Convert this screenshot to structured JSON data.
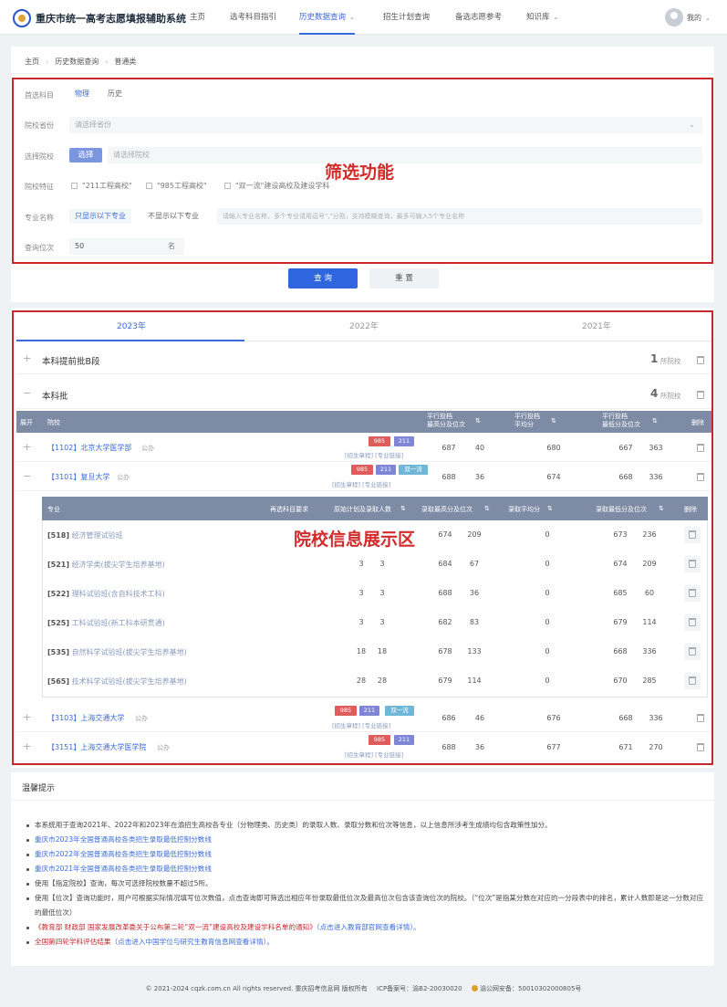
{
  "app": {
    "title": "重庆市统一高考志愿填报辅助系统"
  },
  "nav": {
    "items": [
      {
        "label": "主页"
      },
      {
        "label": "选考科目指引"
      },
      {
        "label": "历史数据查询"
      },
      {
        "label": "招生计划查询"
      },
      {
        "label": "备选志愿参考"
      },
      {
        "label": "知识库"
      }
    ],
    "user_label": "我的"
  },
  "breadcrumb": [
    "主页",
    "历史数据查询",
    "普通类"
  ],
  "filter": {
    "subject_label": "首选科目",
    "subject_options": [
      "物理",
      "历史"
    ],
    "province_label": "院校省份",
    "province_placeholder": "请选择省份",
    "school_label": "选择院校",
    "school_button": "选择",
    "school_placeholder": "请选择院校",
    "feature_label": "院校特征",
    "feature_options": [
      "\"211工程高校\"",
      "\"985工程高校\"",
      "\"双一流\"建设高校及建设学科"
    ],
    "major_label": "专业名称",
    "major_options": [
      "只显示以下专业",
      "不显示以下专业"
    ],
    "major_placeholder": "请输入专业名称，多个专业请用逗号\",\"分割，支持模糊查询，最多可输入5个专业名称",
    "rank_label": "查询位次",
    "rank_value": "50",
    "rank_unit": "名",
    "annotation": "筛选功能"
  },
  "actions": {
    "query": "查 询",
    "reset": "重 置"
  },
  "tabs": [
    "2023年",
    "2022年",
    "2021年"
  ],
  "sections": [
    {
      "title": "本科提前批B段",
      "count": "1",
      "count_label": "所院校"
    },
    {
      "title": "本科批",
      "count": "4",
      "count_label": "所院校"
    }
  ],
  "table_header": {
    "expand": "展开",
    "school": "院校",
    "max": "平行投档\n最高分及位次",
    "avg": "平行投档\n平均分",
    "min": "平行投档\n最低分及位次",
    "delete": "删除"
  },
  "universities": [
    {
      "name": "【1102】北京大学医学部",
      "loc": "公办",
      "tags": [
        "985",
        "211"
      ],
      "links": "[招生章程] [专业链接]",
      "max_score": "687",
      "max_rank": "40",
      "avg": "680",
      "min_score": "667",
      "min_rank": "363"
    },
    {
      "name": "【3101】复旦大学",
      "loc": "公办",
      "tags": [
        "985",
        "211",
        "双一流"
      ],
      "links": "[招生章程] [专业链接]",
      "max_score": "688",
      "max_rank": "36",
      "avg": "674",
      "min_score": "668",
      "min_rank": "336"
    },
    {
      "name": "【3103】上海交通大学",
      "loc": "公办",
      "tags": [
        "985",
        "211",
        "双一流"
      ],
      "links": "[招生章程] [专业链接]",
      "max_score": "686",
      "max_rank": "46",
      "avg": "676",
      "min_score": "668",
      "min_rank": "336"
    },
    {
      "name": "【3151】上海交通大学医学院",
      "loc": "公办",
      "tags": [
        "985",
        "211"
      ],
      "links": "[招生章程] [专业链接]",
      "max_score": "688",
      "max_rank": "36",
      "avg": "677",
      "min_score": "671",
      "min_rank": "270"
    }
  ],
  "major_header": {
    "major": "专业",
    "requirement": "再选科目要求",
    "plan": "原始计划及录取人数",
    "max": "录取最高分及位次",
    "avg": "录取平均分",
    "min": "录取最低分及位次",
    "delete": "删除"
  },
  "majors": [
    {
      "code": "[518]",
      "name": "经济管理试验班",
      "plan": "",
      "admit": "",
      "max_score": "674",
      "max_rank": "209",
      "avg": "0",
      "min_score": "673",
      "min_rank": "236"
    },
    {
      "code": "[521]",
      "name": "经济学类(拔尖学生培养基地)",
      "plan": "3",
      "admit": "3",
      "max_score": "684",
      "max_rank": "67",
      "avg": "0",
      "min_score": "674",
      "min_rank": "209"
    },
    {
      "code": "[522]",
      "name": "理科试验班(含自科技术工科)",
      "plan": "3",
      "admit": "3",
      "max_score": "688",
      "max_rank": "36",
      "avg": "0",
      "min_score": "685",
      "min_rank": "60"
    },
    {
      "code": "[525]",
      "name": "工科试验班(新工科本研贯通)",
      "plan": "3",
      "admit": "3",
      "max_score": "682",
      "max_rank": "83",
      "avg": "0",
      "min_score": "679",
      "min_rank": "114"
    },
    {
      "code": "[535]",
      "name": "自然科学试验班(拔尖学生培养基地)",
      "plan": "18",
      "admit": "18",
      "max_score": "678",
      "max_rank": "133",
      "avg": "0",
      "min_score": "668",
      "min_rank": "336"
    },
    {
      "code": "[565]",
      "name": "技术科学试验班(拔尖学生培养基地)",
      "plan": "28",
      "admit": "28",
      "max_score": "679",
      "max_rank": "114",
      "avg": "0",
      "min_score": "670",
      "min_rank": "285"
    }
  ],
  "results_annotation": "院校信息展示区",
  "tips": {
    "title": "温馨提示",
    "items": [
      "本系统用于查询2021年、2022年和2023年在渝招生高校各专业（分物理类、历史类）的录取人数、录取分数和位次等信息，以上信息所涉考生成绩均包含政策性加分。",
      "重庆市2023年全国普通高校各类招生录取最低控制分数线",
      "重庆市2022年全国普通高校各类招生录取最低控制分数线",
      "重庆市2021年全国普通高校各类招生录取最低控制分数线",
      "使用【指定院校】查询，每次可选择院校数量不超过5所。",
      "使用【位次】查询功能时，用户可根据实际情况填写位次数值，点击查询即可筛选出相应年份录取最低位次及最高位次包含该查询位次的院校。（“位次”是指某分数在对应的一分段表中的排名，累计人数即是这一分数对应的最低位次）",
      "《教育部 财政部 国家发展改革委关于公布第二轮“双一流”建设高校及建设学科名单的通知》",
      "（点击进入教育部官网查看详情）。",
      "全国第四轮学科评估结果",
      "（点击进入中国学位与研究生教育信息网查看详情）。"
    ]
  },
  "footer": {
    "copyright": "© 2021-2024 cqzk.com.cn All rights reserved. 重庆招考信息网 版权所有",
    "icp": "ICP备案号：渝B2-20030020",
    "police": "渝公网安备：50010302000805号"
  },
  "colors": {
    "accent": "#3a6bdc",
    "annotation": "#c9262d",
    "tag985": "#e05c5c",
    "tag211": "#7f86d6",
    "tagdouble": "#6fb7d6"
  }
}
